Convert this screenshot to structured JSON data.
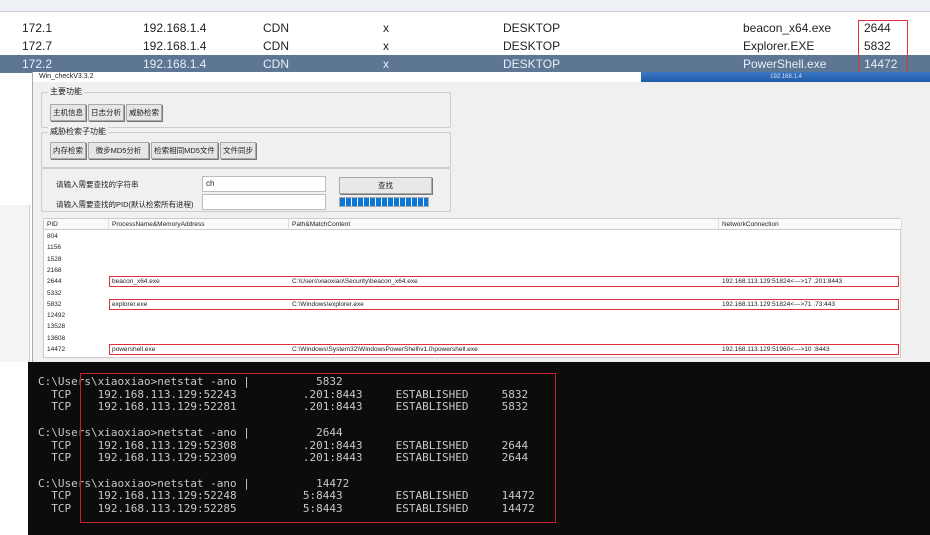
{
  "top_table": {
    "rows": [
      {
        "ext_ip": "172.1",
        "int_ip": "192.168.1.4",
        "host": "CDN",
        "user": "x",
        "computer": "DESKTOP",
        "process": "beacon_x64.exe",
        "pid": "2644",
        "selected": false
      },
      {
        "ext_ip": "172.7",
        "int_ip": "192.168.1.4",
        "host": "CDN",
        "user": "x",
        "computer": "DESKTOP",
        "process": "Explorer.EXE",
        "pid": "5832",
        "selected": false
      },
      {
        "ext_ip": "172.2",
        "int_ip": "192.168.1.4",
        "host": "CDN",
        "user": "x",
        "computer": "DESKTOP",
        "process": "PowerShell.exe",
        "pid": "14472",
        "selected": true
      }
    ]
  },
  "app": {
    "title": "Win_checkV3.3.2",
    "session_ip": "192.168.1.4",
    "main_group": {
      "label": "主要功能",
      "buttons": [
        "主机信息",
        "日志分析",
        "威胁检索"
      ]
    },
    "sub_group": {
      "label": "威胁检索子功能",
      "buttons": [
        "内存检索",
        "微步MD5分析",
        "检索相同MD5文件",
        "文件同步"
      ]
    },
    "search": {
      "string_label": "请输入需要查找的字符串",
      "string_value": "ch",
      "pid_label": "请输入需要查找的PID(默认检索所有进程)",
      "pid_value": "",
      "find_button": "查找",
      "progress": 100
    },
    "table": {
      "headers": [
        "PID",
        "ProcessName&MemoryAddress",
        "Path&MatchContent",
        "NetworkConnection"
      ],
      "rows": [
        {
          "pid": "804",
          "name": "",
          "path": "",
          "net": ""
        },
        {
          "pid": "1156",
          "name": "",
          "path": "",
          "net": ""
        },
        {
          "pid": "1528",
          "name": "",
          "path": "",
          "net": ""
        },
        {
          "pid": "2168",
          "name": "",
          "path": "",
          "net": ""
        },
        {
          "pid": "2644",
          "name": "beacon_x64.exe",
          "path": "C:\\Users\\xiaoxiao\\Security\\beacon_x64.exe",
          "net": "192.168.113.129:51824<--->17 .201:8443"
        },
        {
          "pid": "5332",
          "name": "",
          "path": "",
          "net": ""
        },
        {
          "pid": "5832",
          "name": "explorer.exe",
          "path": "C:\\Windows\\explorer.exe",
          "net": "192.168.113.129:51824<--->71 .73:443"
        },
        {
          "pid": "12492",
          "name": "",
          "path": "",
          "net": ""
        },
        {
          "pid": "13528",
          "name": "",
          "path": "",
          "net": ""
        },
        {
          "pid": "13608",
          "name": "",
          "path": "",
          "net": ""
        },
        {
          "pid": "14472",
          "name": "powershell.exe",
          "path": "C:\\Windows\\System32\\WindowsPowerShell\\v1.0\\powershell.exe",
          "net": "192.168.113.129:51960<--->10 :8443"
        }
      ]
    }
  },
  "terminal": {
    "text": "C:\\Users\\xiaoxiao>netstat -ano |          5832\n  TCP    192.168.113.129:52243          .201:8443     ESTABLISHED     5832\n  TCP    192.168.113.129:52281          .201:8443     ESTABLISHED     5832\n\nC:\\Users\\xiaoxiao>netstat -ano |          2644\n  TCP    192.168.113.129:52308          .201:8443     ESTABLISHED     2644\n  TCP    192.168.113.129:52309          .201:8443     ESTABLISHED     2644\n\nC:\\Users\\xiaoxiao>netstat -ano |          14472\n  TCP    192.168.113.129:52248          5:8443        ESTABLISHED     14472\n  TCP    192.168.113.129:52285          5:8443        ESTABLISHED     14472"
  }
}
